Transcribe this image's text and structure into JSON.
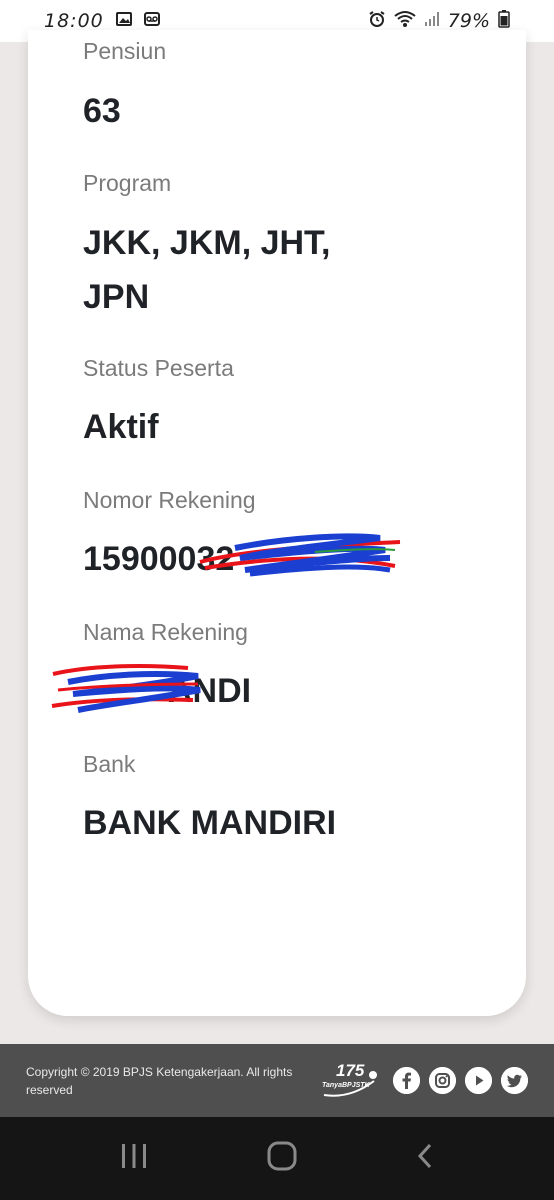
{
  "status_bar": {
    "time": "18:00",
    "battery": "79%"
  },
  "fields": [
    {
      "label": "Pensiun",
      "value": "63"
    },
    {
      "label": "Program",
      "value_line1": "JKK, JKM, JHT,",
      "value_line2": "JPN"
    },
    {
      "label": "Status Peserta",
      "value": "Aktif"
    },
    {
      "label": "Nomor Rekening",
      "value": "15900032"
    },
    {
      "label": "Nama Rekening",
      "value": "ANDI"
    },
    {
      "label": "Bank",
      "value": "BANK MANDIRI"
    }
  ],
  "footer": {
    "copyright": "Copyright © 2019 BPJS Ketengakerjaan. All rights reserved",
    "hotline": "175",
    "hotline_caption": "TanyaBPJSTK",
    "social_icons": [
      "facebook-icon",
      "instagram-icon",
      "youtube-icon",
      "twitter-icon"
    ]
  },
  "colors": {
    "label": "#7b7b7b",
    "value": "#1f2227",
    "footer_bg": "#4f4f4f",
    "scribble_red": "#e8141a",
    "scribble_blue": "#1b3fd0"
  }
}
